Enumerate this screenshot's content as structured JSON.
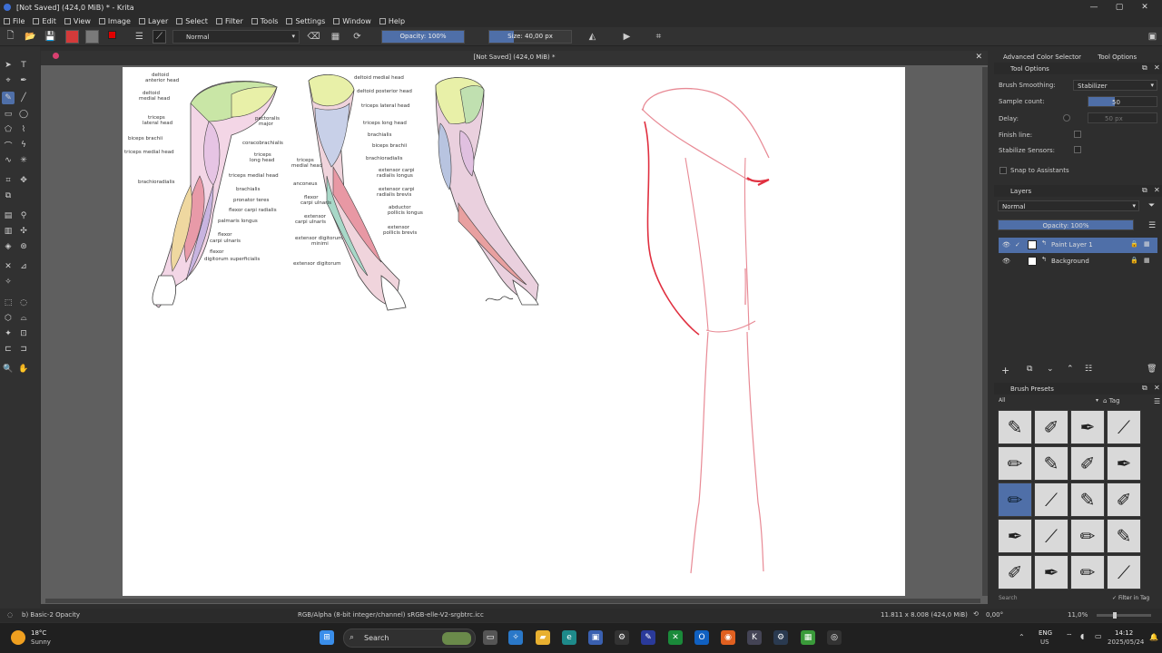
{
  "window": {
    "title": "[Not Saved] (424,0 MiB) * - Krita",
    "minimize": "—",
    "maximize": "▢",
    "close": "✕"
  },
  "menu": [
    "File",
    "Edit",
    "View",
    "Image",
    "Layer",
    "Select",
    "Filter",
    "Tools",
    "Settings",
    "Window",
    "Help"
  ],
  "toolbar": {
    "blend_mode": "Normal",
    "opacity_label": "Opacity: 100%",
    "opacity_value": 100,
    "size_label": "Size: 40,00 px"
  },
  "document": {
    "tab_title": "[Not Saved] (424,0 MiB) *",
    "close": "✕"
  },
  "reference": {
    "arm1": [
      "deltoid",
      "anterior head",
      "deltoid",
      "medial head",
      "pectoralis",
      "major",
      "triceps",
      "lateral head",
      "biceps brachii",
      "coracobrachialis",
      "triceps medial head",
      "triceps",
      "long head",
      "triceps medial head",
      "brachioradialis",
      "brachialis",
      "pronator teres",
      "flexor carpi radialis",
      "palmaris longus",
      "flexor",
      "carpi ulnaris",
      "flexor",
      "digitorum superficialis"
    ],
    "arm2": [
      "deltoid medial head",
      "deltoid posterior head",
      "triceps lateral head",
      "triceps long head",
      "brachialis",
      "biceps brachii",
      "brachioradialis",
      "triceps",
      "medial head",
      "extensor carpi",
      "radialis longus",
      "anconeus",
      "extensor carpi",
      "radialis brevis",
      "flexor",
      "carpi ulnaris",
      "abductor",
      "pollicis longus",
      "extensor",
      "carpi ulnaris",
      "extensor",
      "pollicis brevis",
      "extensor digitorum",
      "minimi",
      "extensor digitorum"
    ]
  },
  "tool_options": {
    "tabs": [
      "Advanced Color Selector",
      "Tool Options"
    ],
    "header": "Tool Options",
    "brush_smoothing_label": "Brush Smoothing:",
    "brush_smoothing_value": "Stabilizer",
    "sample_count_label": "Sample count:",
    "sample_count_value": "50",
    "delay_label": "Delay:",
    "delay_value": "50 px",
    "finish_line_label": "Finish line:",
    "stabilize_sensors_label": "Stabilize Sensors:",
    "snap_label": "Snap to Assistants"
  },
  "layers": {
    "header": "Layers",
    "blend_mode": "Normal",
    "opacity_label": "Opacity: 100%",
    "opacity_value": 100,
    "items": [
      {
        "name": "Paint Layer 1",
        "selected": true
      },
      {
        "name": "Background",
        "selected": false
      }
    ]
  },
  "brush_presets": {
    "header": "Brush Presets",
    "filter": "All",
    "tag_label": "Tag",
    "search_placeholder": "Search",
    "filter_in_tag": "Filter in Tag",
    "count": 20,
    "selected_index": 8
  },
  "status": {
    "brush": "b) Basic-2 Opacity",
    "color_profile": "RGB/Alpha (8-bit integer/channel)  sRGB-elle-V2-srgbtrc.icc",
    "dimensions": "11.811 x 8.008 (424,0 MiB)",
    "rotation": "0,00°",
    "zoom": "11,0%"
  },
  "taskbar": {
    "weather_temp": "18°C",
    "weather_desc": "Sunny",
    "search": "Search",
    "lang1": "ENG",
    "lang2": "US",
    "time": "14:12",
    "date": "2025/05/24"
  },
  "colors": {
    "accent": "#4f6fa8",
    "sketch_red": "#e03040",
    "sketch_pink": "#e88a95"
  }
}
